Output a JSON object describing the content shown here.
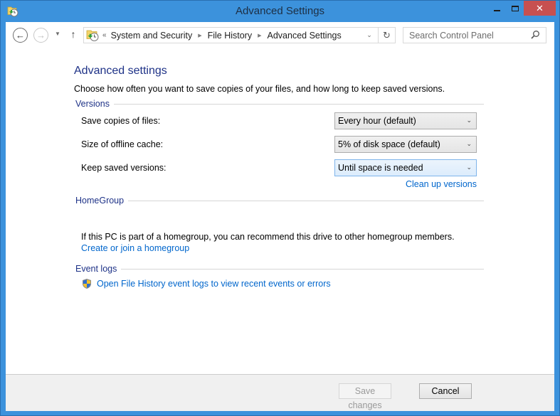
{
  "window": {
    "title": "Advanced Settings",
    "close_glyph": "✕",
    "accent": "#3c92dc",
    "close_color": "#c75050"
  },
  "navbar": {
    "back_glyph": "←",
    "forward_glyph": "→",
    "recent_glyph": "▼",
    "up_glyph": "↑",
    "overflow_glyph": "«",
    "breadcrumbs": [
      "System and Security",
      "File History",
      "Advanced Settings"
    ],
    "crumb_sep": "▶",
    "dropdown_glyph": "⌄",
    "refresh_glyph": "↻",
    "search_placeholder": "Search Control Panel"
  },
  "main": {
    "title": "Advanced settings",
    "intro": "Choose how often you want to save copies of your files, and how long to keep saved versions.",
    "versions": {
      "header": "Versions",
      "rows": [
        {
          "label": "Save copies of files:",
          "value": "Every hour (default)"
        },
        {
          "label": "Size of offline cache:",
          "value": "5% of disk space (default)"
        },
        {
          "label": "Keep saved versions:",
          "value": "Until space is needed"
        }
      ],
      "cleanup_link": "Clean up versions"
    },
    "homegroup": {
      "header": "HomeGroup",
      "text": "If this PC is part of a homegroup, you can recommend this drive to other homegroup members.",
      "link": "Create or join a homegroup"
    },
    "event_logs": {
      "header": "Event logs",
      "link": "Open File History event logs to view recent events or errors"
    }
  },
  "footer": {
    "save_label": "Save changes",
    "cancel_label": "Cancel"
  },
  "select_chevron": "⌄"
}
